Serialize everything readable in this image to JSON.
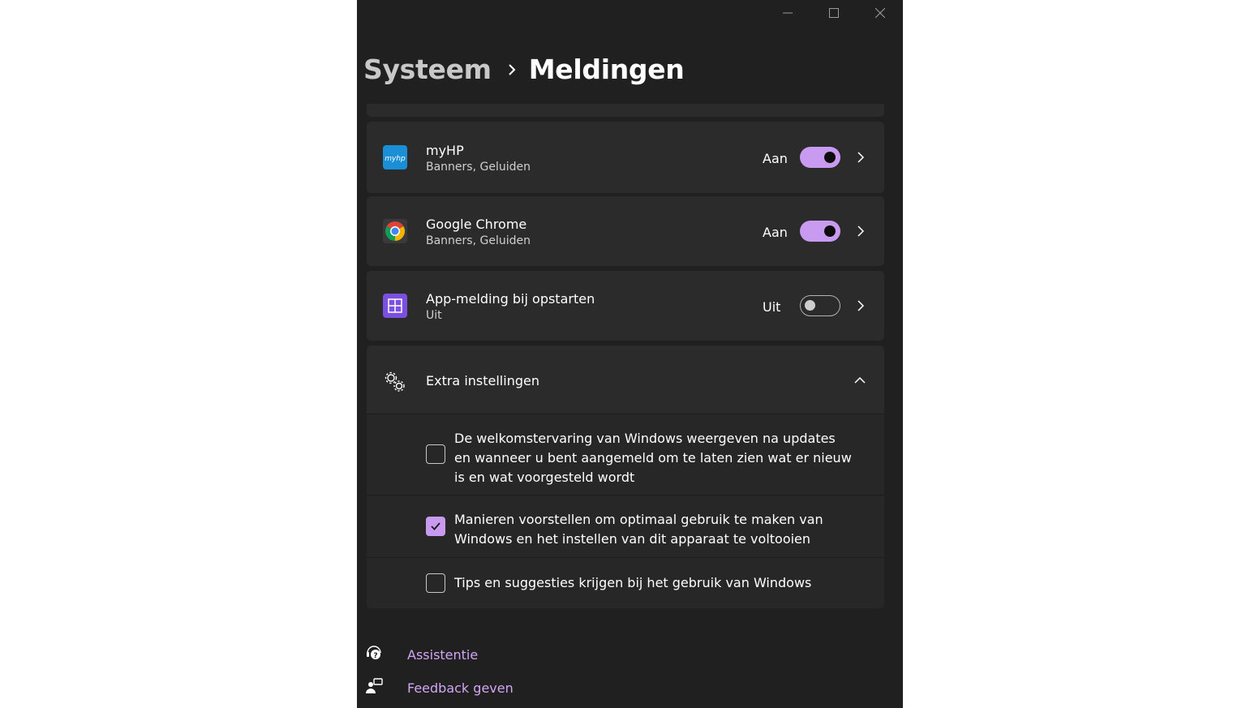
{
  "window": {
    "caption": {
      "minimize_icon": "minimize-icon",
      "maximize_icon": "maximize-icon",
      "close_icon": "close-icon"
    }
  },
  "breadcrumb": {
    "parent": "Systeem",
    "current": "Meldingen"
  },
  "apps": [
    {
      "name": "myHP",
      "subtitle": "Banners, Geluiden",
      "state": "Aan",
      "toggle_on": true,
      "icon": "myhp-icon",
      "icon_text": "myhp",
      "icon_color": "#1a8fd6"
    },
    {
      "name": "Google Chrome",
      "subtitle": "Banners, Geluiden",
      "state": "Aan",
      "toggle_on": true,
      "icon": "chrome-icon"
    },
    {
      "name": "App-melding bij opstarten",
      "subtitle": "Uit",
      "state": "Uit",
      "toggle_on": false,
      "icon": "startup-apps-icon",
      "icon_color": "#7b4fe0"
    }
  ],
  "extra": {
    "title": "Extra instellingen",
    "expanded": true,
    "icon": "gears-icon",
    "options": [
      {
        "text": "De welkomstervaring van Windows weergeven na updates en wanneer u bent aangemeld om te laten zien wat er nieuw is en wat voorgesteld wordt",
        "checked": false
      },
      {
        "text": "Manieren voorstellen om optimaal gebruik te maken van Windows en het instellen van dit apparaat te voltooien",
        "checked": true
      },
      {
        "text": "Tips en suggesties krijgen bij het gebruik van Windows",
        "checked": false
      }
    ]
  },
  "links": [
    {
      "label": "Assistentie",
      "icon": "help-icon"
    },
    {
      "label": "Feedback geven",
      "icon": "feedback-icon"
    }
  ],
  "colors": {
    "accent": "#c99bf0",
    "link": "#d2a6f5",
    "background": "#202020",
    "card": "#2b2b2b"
  }
}
